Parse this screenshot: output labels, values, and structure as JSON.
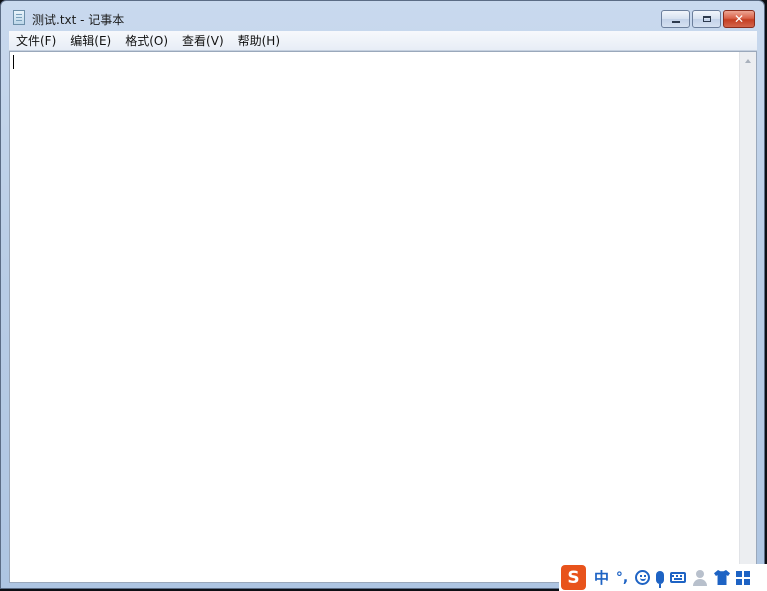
{
  "window": {
    "title": "测试.txt - 记事本",
    "buttons": {
      "minimize": "minimize",
      "maximize": "maximize",
      "close": "✕"
    }
  },
  "menu": [
    {
      "label": "文件(F)"
    },
    {
      "label": "编辑(E)"
    },
    {
      "label": "格式(O)"
    },
    {
      "label": "查看(V)"
    },
    {
      "label": "帮助(H)"
    }
  ],
  "editor": {
    "content": ""
  },
  "ime": {
    "logo": "S",
    "mode": "中",
    "punctuation": "°,",
    "icons": [
      "emoji-icon",
      "microphone-icon",
      "keyboard-icon",
      "user-icon",
      "skin-shirt-icon",
      "toolbox-grid-icon"
    ]
  },
  "colors": {
    "ime_accent": "#1e63c4",
    "ime_logo": "#e8531b",
    "close_button": "#c43e22"
  }
}
